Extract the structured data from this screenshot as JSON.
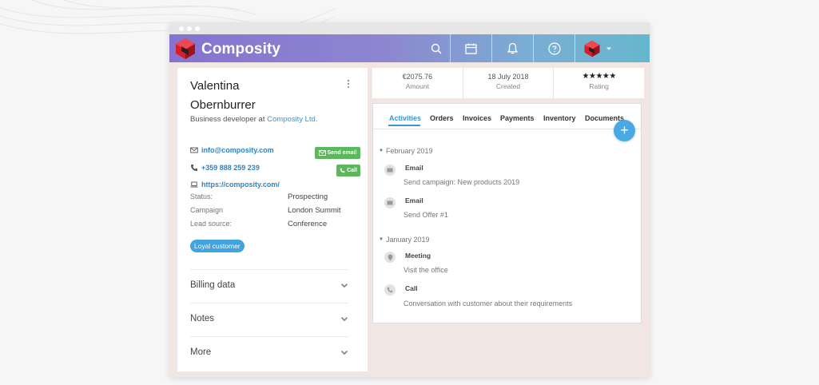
{
  "app": {
    "brand": "Composity",
    "colors": {
      "appbar_gradient": [
        "#8673cf",
        "#66b7cd"
      ],
      "accent": "#3a96d4",
      "green": "#5cb85c",
      "logo_red": "#d71f2b"
    },
    "nav_icons": [
      "search-icon",
      "calendar-icon",
      "bell-icon",
      "help-icon",
      "user-menu-icon"
    ]
  },
  "contact": {
    "first_name": "Valentina",
    "last_name": "Obernburrer",
    "role_prefix": "Business developer at",
    "company": "Composity Ltd.",
    "email": "info@composity.com",
    "phone": "+359 888 259 239",
    "website": "https://composity.com/",
    "send_email_label": "Send email",
    "call_label": "Call",
    "fields": [
      {
        "label": "Status:",
        "value": "Prospecting"
      },
      {
        "label": "Campaign",
        "value": "London Summit"
      },
      {
        "label": "Lead source:",
        "value": "Conference"
      }
    ],
    "tag": "Loyal customer",
    "sections": [
      "Billing data",
      "Notes",
      "More"
    ]
  },
  "stats": [
    {
      "value": "€2075.76",
      "label": "Amount"
    },
    {
      "value": "18 July 2018",
      "label": "Created"
    },
    {
      "stars": "★★★★★",
      "label": "Rating",
      "rating": 5
    }
  ],
  "tabs": [
    "Activities",
    "Orders",
    "Invoices",
    "Payments",
    "Inventory",
    "Documents"
  ],
  "active_tab": "Activities",
  "fab_label": "+",
  "timeline": [
    {
      "month": "February 2019",
      "items": [
        {
          "type": "Email",
          "icon": "email-icon",
          "description": "Send campaign: New products 2019"
        },
        {
          "type": "Email",
          "icon": "email-icon",
          "description": "Send Offer #1"
        }
      ]
    },
    {
      "month": "January 2019",
      "items": [
        {
          "type": "Meeting",
          "icon": "location-pin-icon",
          "description": "Visit the office"
        },
        {
          "type": "Call",
          "icon": "phone-icon",
          "description": "Conversation with customer about their requirements"
        }
      ]
    }
  ]
}
